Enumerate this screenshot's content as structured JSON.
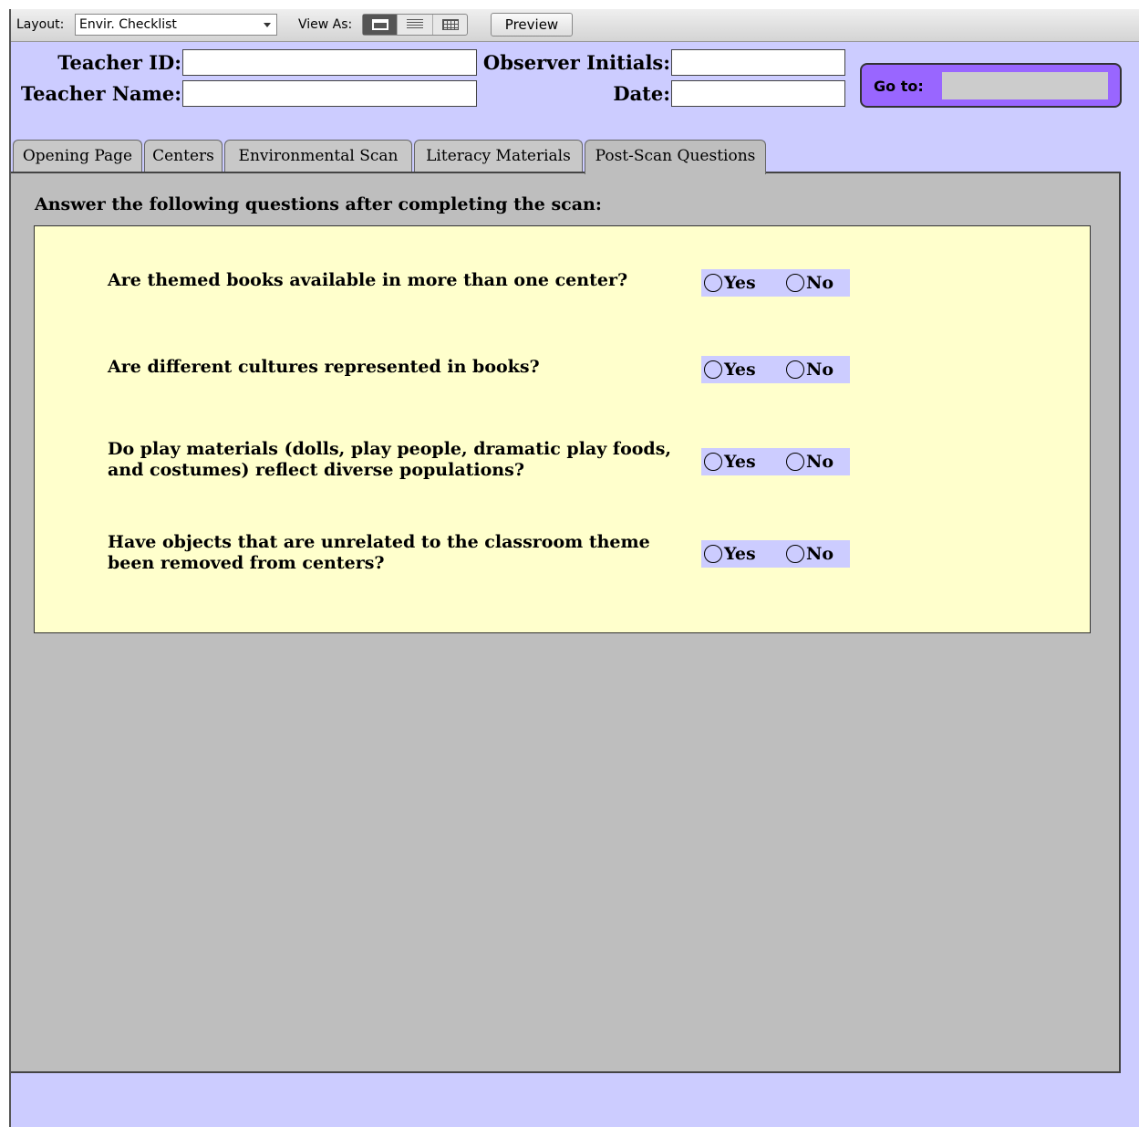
{
  "toolbar": {
    "layout_label": "Layout:",
    "layout_value": "Envir. Checklist",
    "view_as_label": "View As:",
    "preview_label": "Preview"
  },
  "header": {
    "teacher_id_label": "Teacher ID:",
    "teacher_id_value": "",
    "teacher_name_label": "Teacher Name:",
    "teacher_name_value": "",
    "observer_initials_label": "Observer Initials:",
    "observer_initials_value": "",
    "date_label": "Date:",
    "date_value": "",
    "goto_label": "Go to:",
    "goto_value": ""
  },
  "tabs": [
    {
      "label": "Opening Page",
      "active": false
    },
    {
      "label": "Centers",
      "active": false
    },
    {
      "label": "Environmental Scan",
      "active": false
    },
    {
      "label": "Literacy Materials",
      "active": false
    },
    {
      "label": "Post-Scan Questions",
      "active": true
    }
  ],
  "panel": {
    "instructions": "Answer the following questions after completing the scan:",
    "questions": [
      {
        "text": "Are themed books available in more than one center?",
        "yes": "Yes",
        "no": "No",
        "answer": ""
      },
      {
        "text": "Are different cultures represented in books?",
        "yes": "Yes",
        "no": "No",
        "answer": ""
      },
      {
        "text": "Do play materials (dolls, play people, dramatic play foods, and costumes) reflect diverse populations?",
        "yes": "Yes",
        "no": "No",
        "answer": ""
      },
      {
        "text": "Have objects that are unrelated to the classroom theme been removed from centers?",
        "yes": "Yes",
        "no": "No",
        "answer": ""
      }
    ]
  },
  "colors": {
    "background": "#ccccff",
    "panel": "#bebebe",
    "question_area": "#ffffcc",
    "goto_box": "#9966ff",
    "radio_group": "#ccccff"
  },
  "icons": {
    "view_form": "view-as-form-icon",
    "view_list": "view-as-list-icon",
    "view_table": "view-as-table-icon",
    "dropdown": "chevron-down-icon"
  }
}
